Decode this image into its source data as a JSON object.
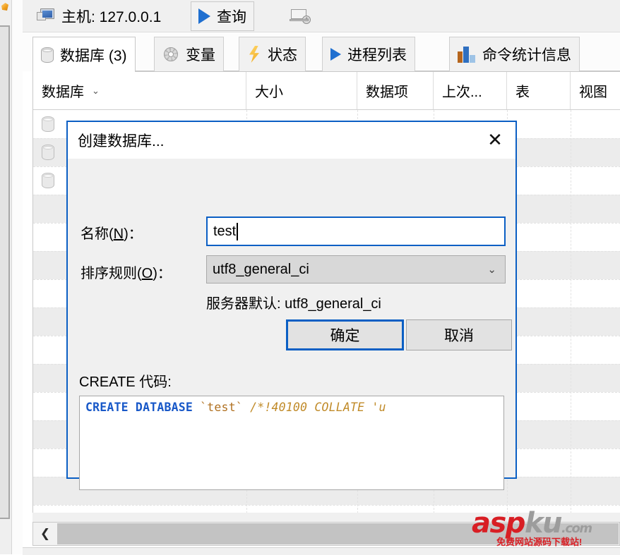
{
  "toolbar": {
    "host_icon": "monitor-icon",
    "host_label": "主机: 127.0.0.1",
    "query_icon": "play-triangle-icon",
    "query_label": "查询",
    "new_session_icon": "laptop-gear-icon"
  },
  "tabs": [
    {
      "label": "数据库 (3)",
      "icon": "database-cylinder-icon",
      "active": true
    },
    {
      "label": "变量",
      "icon": "gear-icon",
      "active": false
    },
    {
      "label": "状态",
      "icon": "lightning-bolt-icon",
      "active": false
    },
    {
      "label": "进程列表",
      "icon": "play-triangle-icon",
      "active": false
    },
    {
      "label": "命令统计信息",
      "icon": "bar-chart-icon",
      "active": false
    }
  ],
  "grid": {
    "columns": [
      {
        "label": "数据库",
        "has_sort_caret": true
      },
      {
        "label": "大小",
        "has_sort_caret": false
      },
      {
        "label": "数据项",
        "has_sort_caret": false
      },
      {
        "label": "上次...",
        "has_sort_caret": false
      },
      {
        "label": "表",
        "has_sort_caret": false
      },
      {
        "label": "视图",
        "has_sort_caret": false
      }
    ],
    "row_count": 3,
    "row_icon": "database-cylinder-icon"
  },
  "dialog": {
    "title": "创建数据库...",
    "close_icon": "close-x-icon",
    "name_label": "名称(N)：",
    "name_label_plain": "名称(",
    "name_accel": "N",
    "name_label_tail": ")：",
    "name_value": "test",
    "collation_label_plain": "排序规则(",
    "collation_accel": "O",
    "collation_label_tail": ")：",
    "collation_value": "utf8_general_ci",
    "collation_caret_icon": "chevron-down-icon",
    "server_default": "服务器默认: utf8_general_ci",
    "ok_label": "确定",
    "cancel_label": "取消",
    "create_code_label": "CREATE 代码:",
    "code": {
      "keyword": "CREATE DATABASE",
      "object": "`test`",
      "comment": "/*!40100 COLLATE 'u"
    }
  },
  "scrollbar": {
    "left_arrow_icon": "chevron-left-icon",
    "left_arrow_glyph": "❮"
  },
  "watermark": {
    "brand_red": "asp",
    "brand_gray": "ku",
    "brand_com": ".com",
    "tagline": "免费网站源码下载站!"
  },
  "colors": {
    "accent_blue": "#0b5fc4",
    "watermark_red": "#d81e24",
    "code_keyword": "#1858c8",
    "code_comment": "#c08a28"
  }
}
